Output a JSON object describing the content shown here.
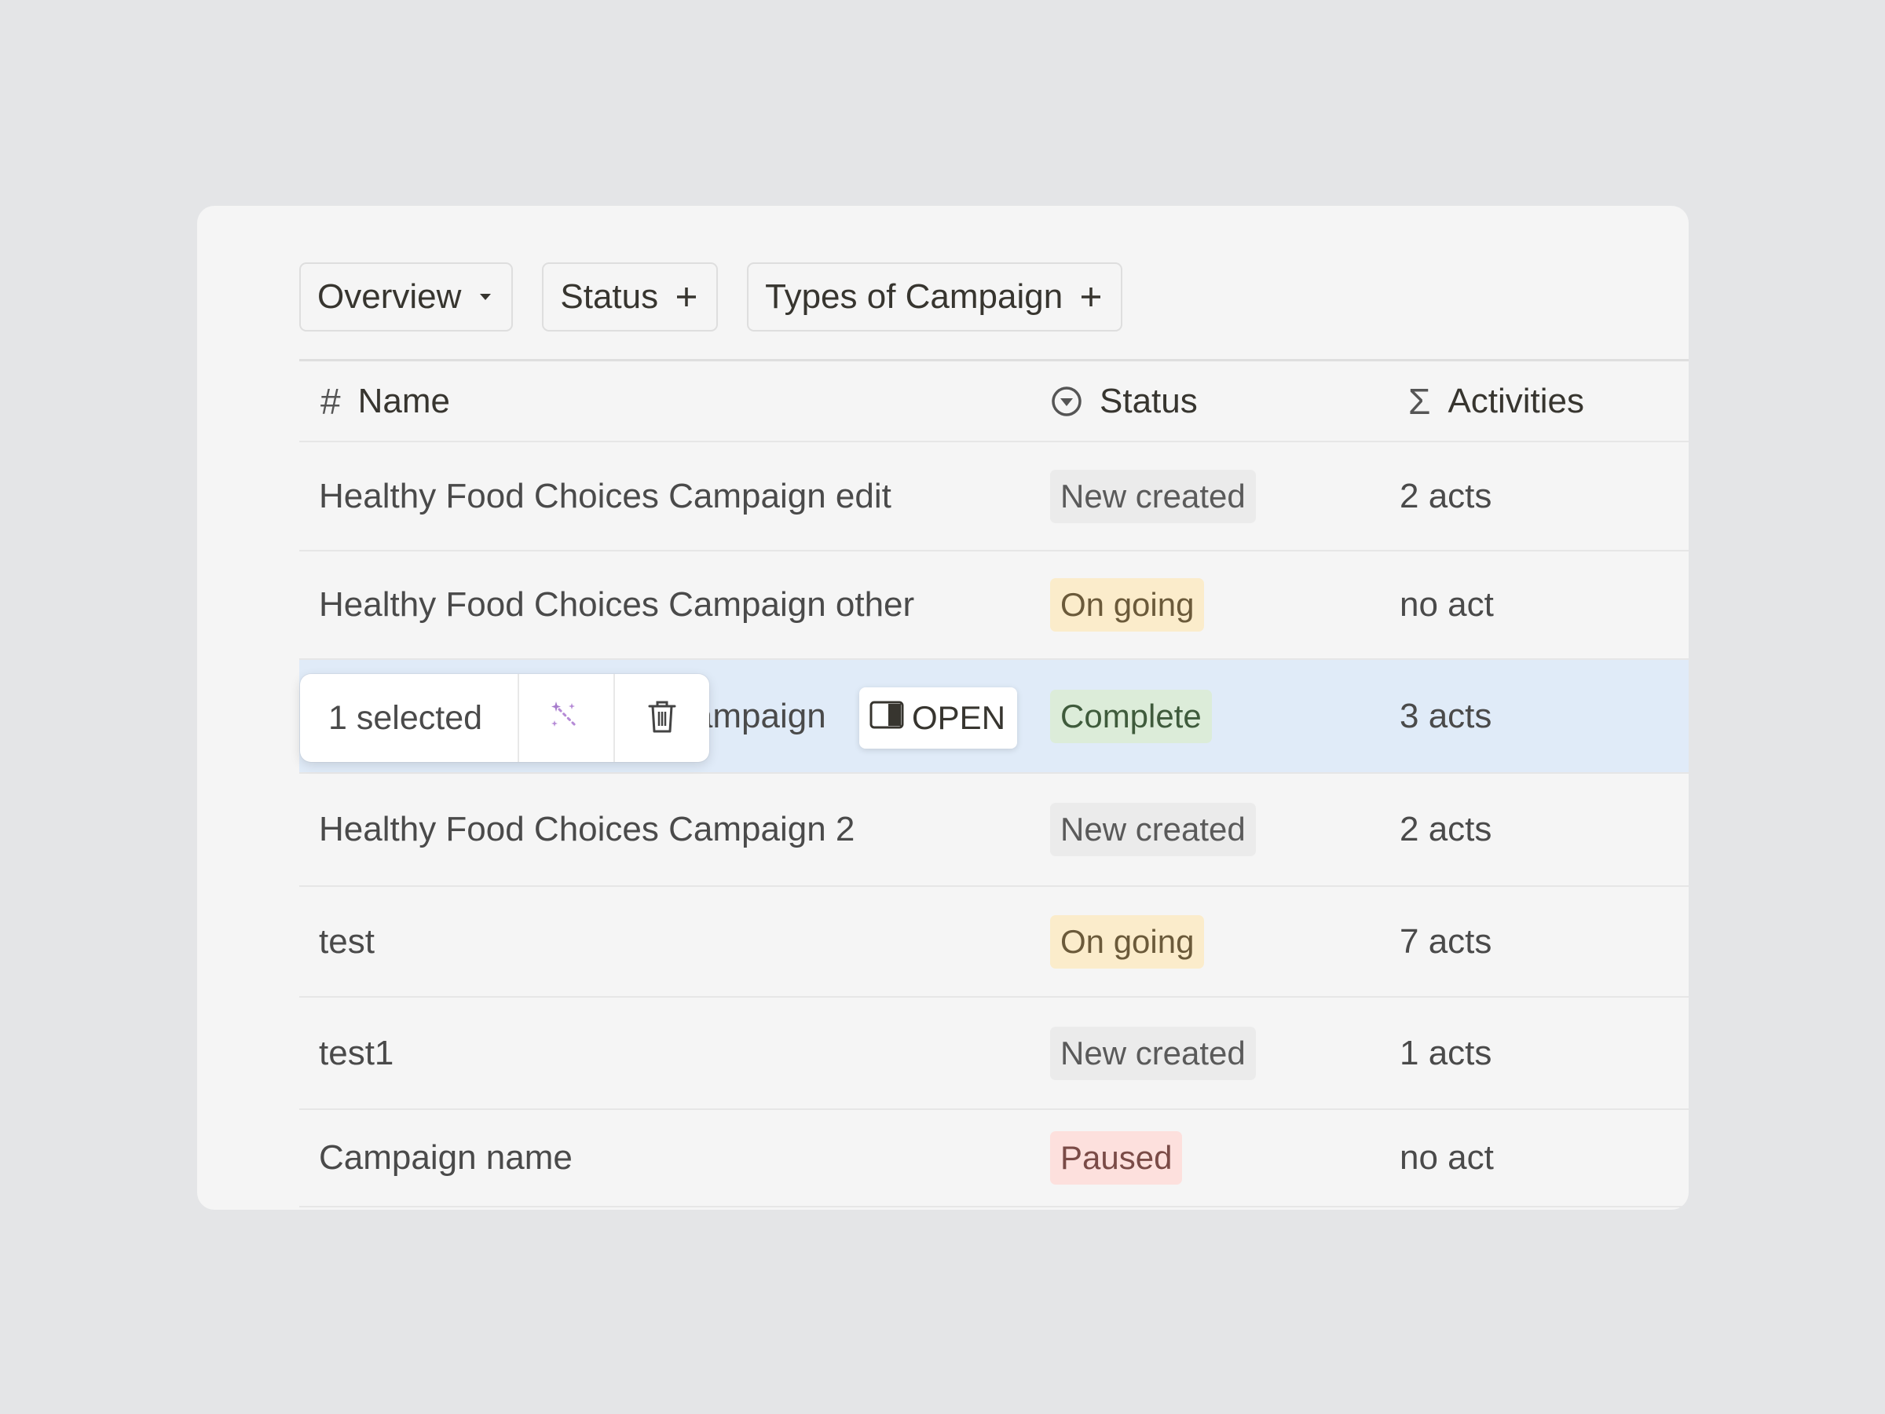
{
  "filters": [
    {
      "label": "Overview",
      "icon": "caret-down-icon"
    },
    {
      "label": "Status",
      "icon": "plus-icon"
    },
    {
      "label": "Types of Campaign",
      "icon": "plus-icon"
    }
  ],
  "columns": {
    "name": {
      "label": "Name",
      "icon": "#"
    },
    "status": {
      "label": "Status",
      "icon": "status-select-icon"
    },
    "activities": {
      "label": "Activities",
      "icon": "Σ"
    }
  },
  "rows": [
    {
      "name": "Healthy Food Choices Campaign edit",
      "status": "New created",
      "acts": "2 acts"
    },
    {
      "name": "Healthy Food Choices Campaign other",
      "status": "On going",
      "acts": "no act"
    },
    {
      "name": "Healthy Food Choices Campaign",
      "status": "Complete",
      "acts": "3 acts"
    },
    {
      "name": "Healthy Food Choices Campaign 2",
      "status": "New created",
      "acts": "2 acts"
    },
    {
      "name": "test",
      "status": "On going",
      "acts": "7 acts"
    },
    {
      "name": "test1",
      "status": "New created",
      "acts": "1 acts"
    },
    {
      "name": "Campaign name",
      "status": "Paused",
      "acts": "no act"
    }
  ],
  "status_colors": {
    "New created": {
      "bg": "#ebebeb",
      "fg": "#5a5a5a"
    },
    "On going": {
      "bg": "#fbeccb",
      "fg": "#6b5a3a"
    },
    "Complete": {
      "bg": "#dcecd9",
      "fg": "#3f5b3c"
    },
    "Paused": {
      "bg": "#fde0dd",
      "fg": "#7a4b47"
    }
  },
  "selection": {
    "count_label": "1 selected",
    "actions": [
      {
        "name": "ai-magic-button",
        "icon": "sparkle-wand-icon"
      },
      {
        "name": "delete-button",
        "icon": "trash-icon"
      }
    ],
    "open_label": "OPEN",
    "selected_row": 2
  }
}
